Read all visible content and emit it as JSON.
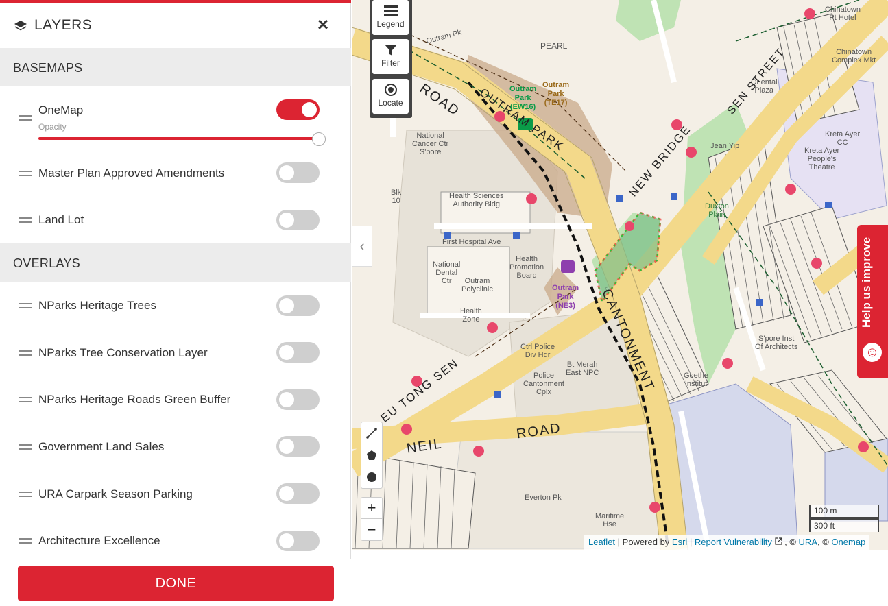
{
  "panel": {
    "title": "LAYERS",
    "close_label": "×",
    "basemaps_heading": "BASEMAPS",
    "basemaps": [
      {
        "label": "OneMap",
        "enabled": true,
        "opacity_label": "Opacity",
        "opacity": 1.0
      },
      {
        "label": "Master Plan Approved Amendments",
        "enabled": false
      },
      {
        "label": "Land Lot",
        "enabled": false
      }
    ],
    "overlays_heading": "OVERLAYS",
    "overlays": [
      {
        "label": "NParks Heritage Trees",
        "enabled": false
      },
      {
        "label": "NParks Tree Conservation Layer",
        "enabled": false
      },
      {
        "label": "NParks Heritage Roads Green Buffer",
        "enabled": false
      },
      {
        "label": "Government Land Sales",
        "enabled": false
      },
      {
        "label": "URA Carpark Season Parking",
        "enabled": false
      },
      {
        "label": "Architecture Excellence",
        "enabled": false
      }
    ],
    "done_label": "DONE"
  },
  "map": {
    "tools": {
      "legend": "Legend",
      "filter": "Filter",
      "locate": "Locate"
    },
    "collapse_label": "‹",
    "zoom_in": "+",
    "zoom_out": "−",
    "help_label": "Help us improve",
    "scale": {
      "metric": "100 m",
      "imperial": "300 ft"
    },
    "attribution": {
      "leaflet": "Leaflet",
      "sep1": " | Powered by ",
      "esri": "Esri",
      "sep2": " | ",
      "report": "Report Vulnerability",
      "sep3": " , © ",
      "ura": "URA",
      "sep4": ", © ",
      "onemap": "Onemap"
    },
    "road_labels": {
      "road1": "ROAD",
      "outram_park_rd": "OUTRAM PARK",
      "cantonment": "CANTONMENT",
      "neil": "NEIL",
      "road2": "ROAD",
      "eu_tong_sen": "EU  TONG  SEN",
      "new_bridge": "NEW  BRIDGE",
      "sen_street": "SEN  STREET"
    },
    "place_labels": {
      "national_cancer": "National\nCancer Ctr\nS'pore",
      "blk10": "Blk\n10",
      "health_sciences": "Health Sciences\nAuthority Bldg",
      "first_hospital": "First Hospital Ave",
      "national_dental": "National\nDental\nCtr",
      "outram_polyclinic": "Outram\nPolyclinic",
      "health_promotion": "Health\nPromotion\nBoard",
      "health_zone": "Health\nZone",
      "police": "Police\nCantonment\nCplx",
      "ctrl_police": "Ctrl Police\nDiv Hqr",
      "bt_merah": "Bt Merah\nEast NPC",
      "chinatown_pt": "Chinatown\nPt Hotel",
      "chinatown_complex": "Chinatown\nComplex Mkt",
      "kreta_ayer_cc": "Kreta Ayer\nCC",
      "kreta_ayer_theatre": "Kreta Ayer\nPeople's\nTheatre",
      "oriental_plaza": "Oriental\nPlaza",
      "jean_yip": "Jean Yip",
      "duxton_plain": "Duxton\nPlain",
      "spore_inst": "S'pore Inst\nOf Architects",
      "everton_pk": "Everton Pk",
      "maritime": "Maritime\nHse",
      "pearl_bank": "PEARL",
      "outram_pk_rd": "Outram Pk",
      "goethe": "Goethe\nInstitut"
    },
    "stations": {
      "outram_ew": "Outram\nPark\n(EW16)",
      "outram_te": "Outram\nPark\n(TE17)",
      "outram_ne": "Outram\nPark\n(NE3)"
    }
  }
}
